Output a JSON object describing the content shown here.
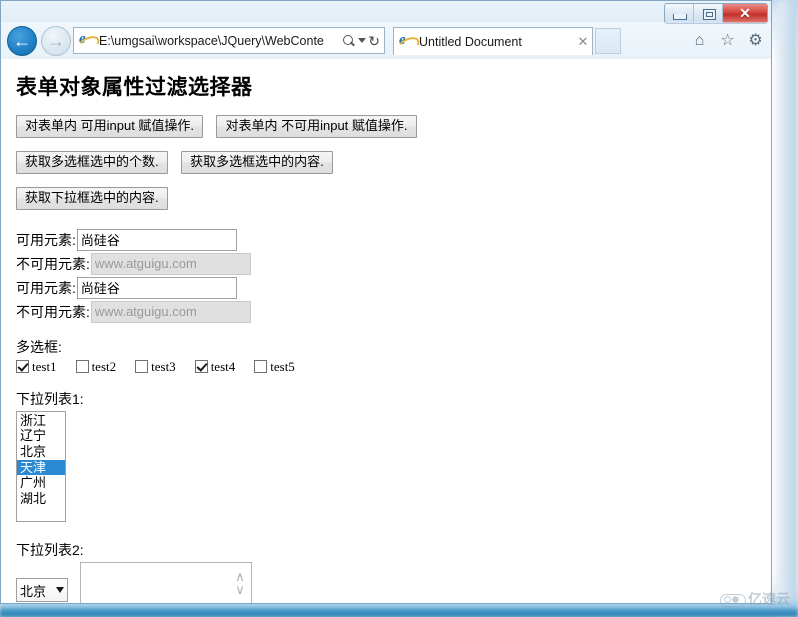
{
  "window": {
    "controls": {
      "minimize": "–",
      "maximize": "☐",
      "close": "✕"
    }
  },
  "browser": {
    "back_icon": "←",
    "forward_icon": "→",
    "address": {
      "url": "E:\\umgsai\\workspace\\JQuery\\WebConte",
      "search_icon": "search-icon",
      "dropdown_icon": "▾",
      "refresh_icon": "↻"
    },
    "tab": {
      "title": "Untitled Document",
      "close_icon": "✕"
    },
    "toolbar": {
      "home_icon": "⌂",
      "favorites_icon": "☆",
      "settings_icon": "⚙"
    }
  },
  "page": {
    "title": "表单对象属性过滤选择器",
    "buttons": [
      {
        "label": "对表单内 可用input 赋值操作."
      },
      {
        "label": "对表单内 不可用input 赋值操作."
      },
      {
        "label": "获取多选框选中的个数."
      },
      {
        "label": "获取多选框选中的内容."
      },
      {
        "label": "获取下拉框选中的内容."
      }
    ],
    "fields": [
      {
        "label": "可用元素:",
        "value": "尚硅谷",
        "disabled": false
      },
      {
        "label": "不可用元素:",
        "value": "www.atguigu.com",
        "disabled": true
      },
      {
        "label": "可用元素:",
        "value": "尚硅谷",
        "disabled": false
      },
      {
        "label": "不可用元素:",
        "value": "www.atguigu.com",
        "disabled": true
      }
    ],
    "checkbox_section": {
      "label": "多选框:",
      "items": [
        {
          "label": "test1",
          "checked": true
        },
        {
          "label": "test2",
          "checked": false
        },
        {
          "label": "test3",
          "checked": false
        },
        {
          "label": "test4",
          "checked": true
        },
        {
          "label": "test5",
          "checked": false
        }
      ]
    },
    "listbox_section": {
      "label": "下拉列表1:",
      "options": [
        {
          "label": "浙江",
          "selected": false
        },
        {
          "label": "辽宁",
          "selected": false
        },
        {
          "label": "北京",
          "selected": false
        },
        {
          "label": "天津",
          "selected": true
        },
        {
          "label": "广州",
          "selected": false
        },
        {
          "label": "湖北",
          "selected": false
        }
      ],
      "selected_color": "#2a8ad4"
    },
    "select_section": {
      "label": "下拉列表2:",
      "selected": "北京",
      "spinner_up": "∧",
      "spinner_down": "∨"
    }
  },
  "watermark": {
    "text": "亿速云",
    "logo": "cloud-icon"
  },
  "backdrop": {
    "blurred_texts": [
      "████",
      "█████",
      "██████",
      "██████████",
      "███████",
      "████████"
    ]
  }
}
